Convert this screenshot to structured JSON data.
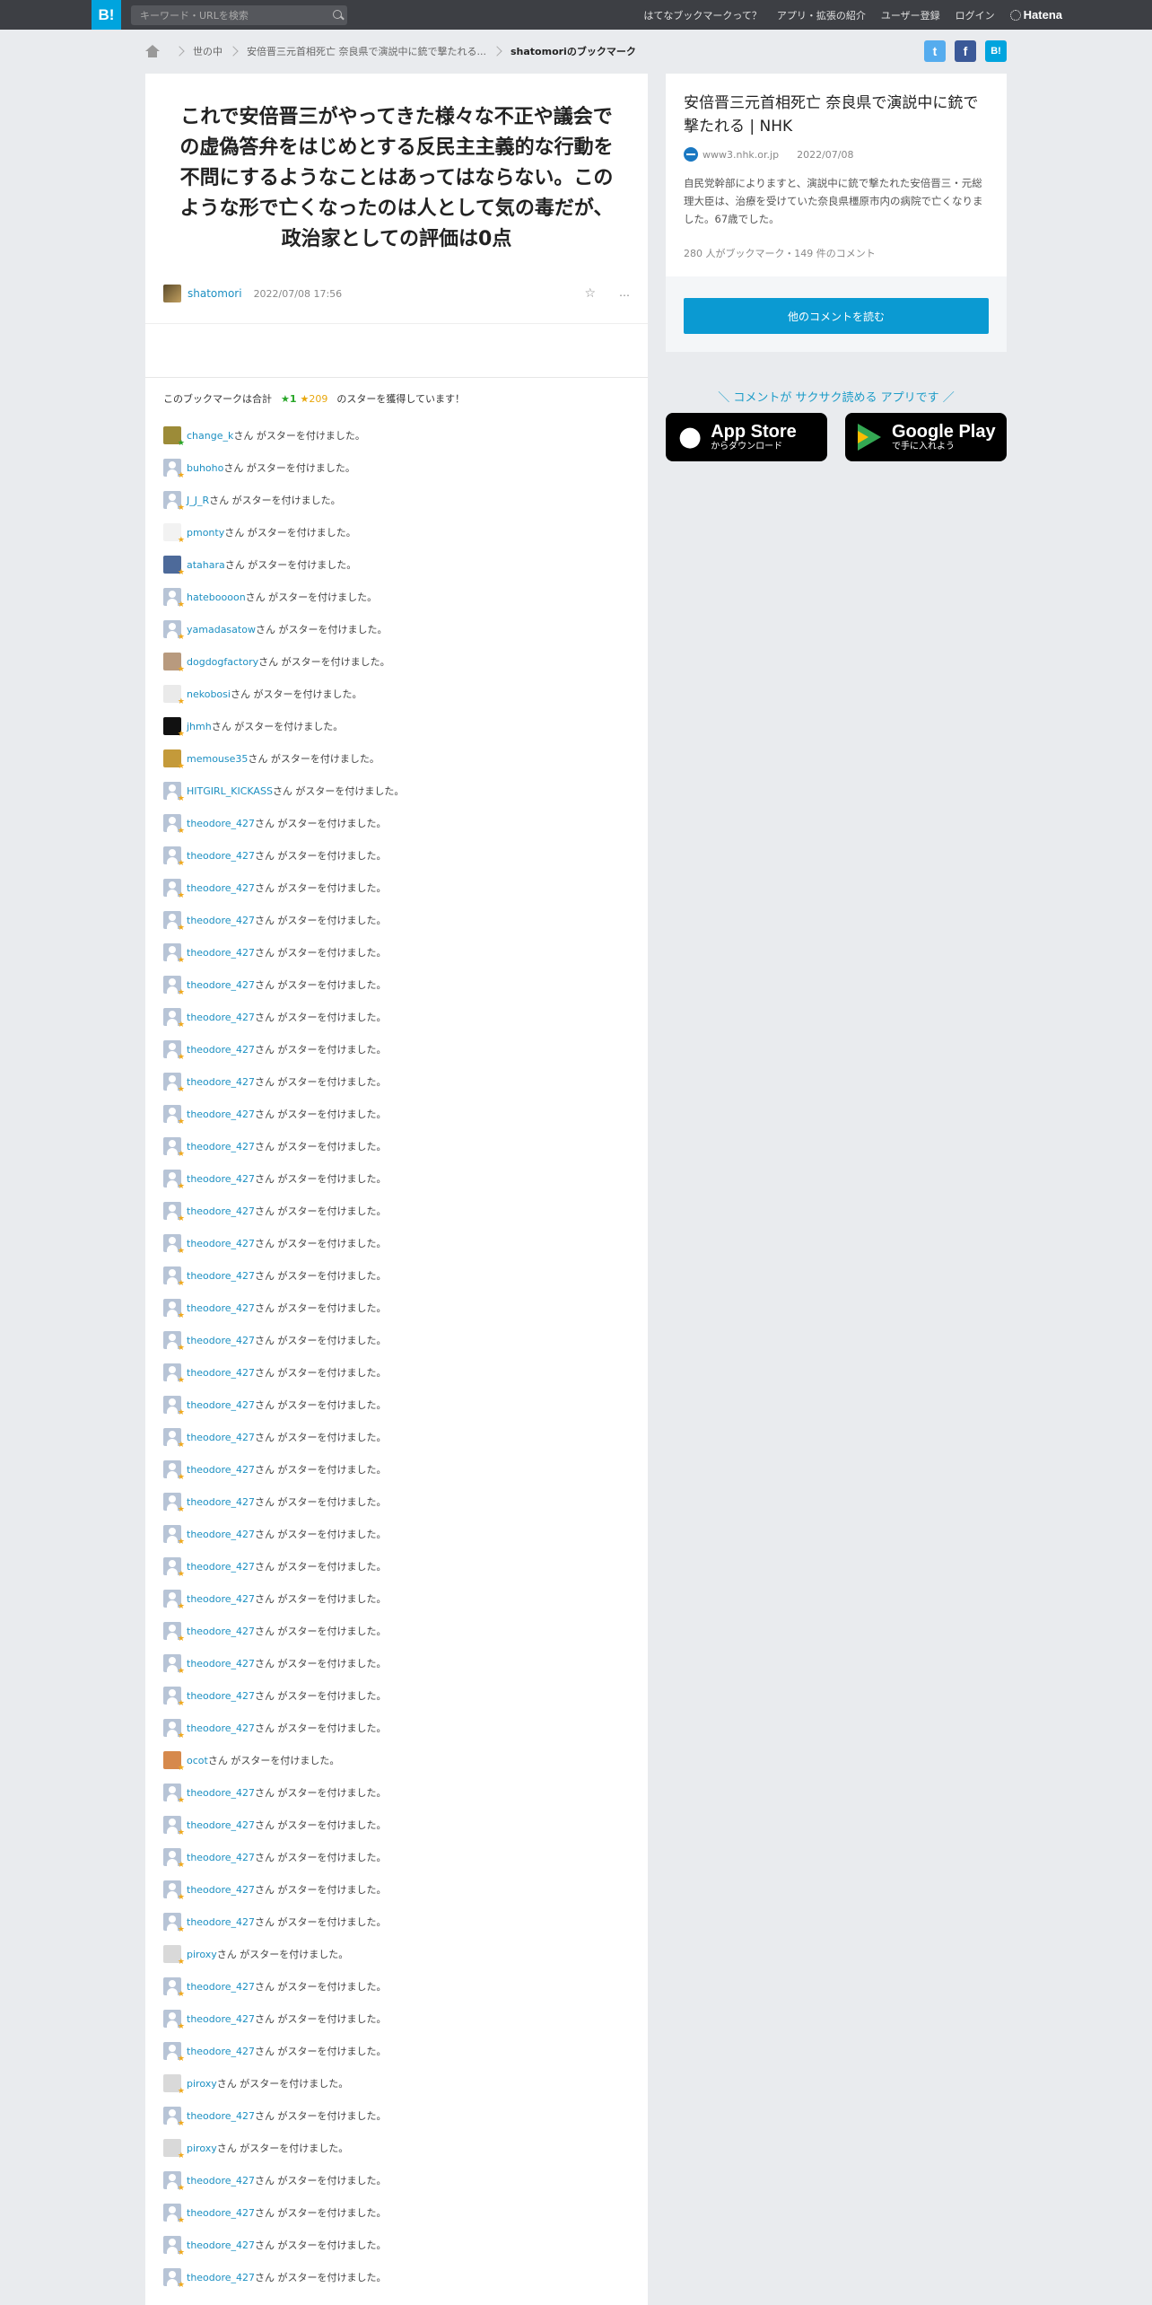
{
  "header": {
    "logo": "B!",
    "search_placeholder": "キーワード・URLを検索",
    "nav": [
      "はてなブックマークって？",
      "アプリ・拡張の紹介",
      "ユーザー登録",
      "ログイン"
    ],
    "hatena": "Hatena"
  },
  "breadcrumb": {
    "items": [
      "世の中",
      "安倍晋三元首相死亡 奈良県で演説中に銃で撃たれる..."
    ],
    "current": "shatomoriのブックマーク"
  },
  "share": {
    "twitter": "t",
    "facebook": "f",
    "hatebu": "B!"
  },
  "comment": {
    "text": "これで安倍晋三がやってきた様々な不正や議会での虚偽答弁をはじめとする反民主主義的な行動を不問にするようなことはあってはならない。このような形で亡くなったのは人として気の毒だが、政治家としての評価は0点",
    "user": "shatomori",
    "date": "2022/07/08 17:56",
    "more": "…"
  },
  "stars_summary": {
    "prefix": "このブックマークは合計",
    "green": "★1",
    "yellow": "★209",
    "suffix": "のスターを獲得しています！"
  },
  "star_suffix": "さん がスターを付けました。",
  "star_users": [
    {
      "name": "change_k",
      "av": "c1",
      "green": true
    },
    {
      "name": "buhoho",
      "av": "def"
    },
    {
      "name": "J_J_R",
      "av": "def"
    },
    {
      "name": "pmonty",
      "av": "c9"
    },
    {
      "name": "atahara",
      "av": "c3"
    },
    {
      "name": "hateboooon",
      "av": "def"
    },
    {
      "name": "yamadasatow",
      "av": "def"
    },
    {
      "name": "dogdogfactory",
      "av": "c4"
    },
    {
      "name": "nekobosi",
      "av": "c5"
    },
    {
      "name": "jhmh",
      "av": "c6"
    },
    {
      "name": "memouse35",
      "av": "c7"
    },
    {
      "name": "HITGIRL_KICKASS",
      "av": "def"
    },
    {
      "name": "theodore_427",
      "av": "def"
    },
    {
      "name": "theodore_427",
      "av": "def"
    },
    {
      "name": "theodore_427",
      "av": "def"
    },
    {
      "name": "theodore_427",
      "av": "def"
    },
    {
      "name": "theodore_427",
      "av": "def"
    },
    {
      "name": "theodore_427",
      "av": "def"
    },
    {
      "name": "theodore_427",
      "av": "def"
    },
    {
      "name": "theodore_427",
      "av": "def"
    },
    {
      "name": "theodore_427",
      "av": "def"
    },
    {
      "name": "theodore_427",
      "av": "def"
    },
    {
      "name": "theodore_427",
      "av": "def"
    },
    {
      "name": "theodore_427",
      "av": "def"
    },
    {
      "name": "theodore_427",
      "av": "def"
    },
    {
      "name": "theodore_427",
      "av": "def"
    },
    {
      "name": "theodore_427",
      "av": "def"
    },
    {
      "name": "theodore_427",
      "av": "def"
    },
    {
      "name": "theodore_427",
      "av": "def"
    },
    {
      "name": "theodore_427",
      "av": "def"
    },
    {
      "name": "theodore_427",
      "av": "def"
    },
    {
      "name": "theodore_427",
      "av": "def"
    },
    {
      "name": "theodore_427",
      "av": "def"
    },
    {
      "name": "theodore_427",
      "av": "def"
    },
    {
      "name": "theodore_427",
      "av": "def"
    },
    {
      "name": "theodore_427",
      "av": "def"
    },
    {
      "name": "theodore_427",
      "av": "def"
    },
    {
      "name": "theodore_427",
      "av": "def"
    },
    {
      "name": "theodore_427",
      "av": "def"
    },
    {
      "name": "theodore_427",
      "av": "def"
    },
    {
      "name": "theodore_427",
      "av": "def"
    },
    {
      "name": "ocot",
      "av": "c8"
    },
    {
      "name": "theodore_427",
      "av": "def"
    },
    {
      "name": "theodore_427",
      "av": "def"
    },
    {
      "name": "theodore_427",
      "av": "def"
    },
    {
      "name": "theodore_427",
      "av": "def"
    },
    {
      "name": "theodore_427",
      "av": "def"
    },
    {
      "name": "piroxy",
      "av": "c2"
    },
    {
      "name": "theodore_427",
      "av": "def"
    },
    {
      "name": "theodore_427",
      "av": "def"
    },
    {
      "name": "theodore_427",
      "av": "def"
    },
    {
      "name": "piroxy",
      "av": "c2"
    },
    {
      "name": "theodore_427",
      "av": "def"
    },
    {
      "name": "piroxy",
      "av": "c2"
    },
    {
      "name": "theodore_427",
      "av": "def"
    },
    {
      "name": "theodore_427",
      "av": "def"
    },
    {
      "name": "theodore_427",
      "av": "def"
    },
    {
      "name": "theodore_427",
      "av": "def"
    }
  ],
  "entry": {
    "title": "安倍晋三元首相死亡 奈良県で演説中に銃で撃たれる | NHK",
    "domain": "www3.nhk.or.jp",
    "date": "2022/07/08",
    "description": "自民党幹部によりますと、演説中に銃で撃たれた安倍晋三・元総理大臣は、治療を受けていた奈良県橿原市内の病院で亡くなりました。67歳でした。",
    "counts": "280 人がブックマーク・149 件のコメント",
    "button": "他のコメントを読む"
  },
  "promo": "＼ コメントが サクサク読める アプリです ／",
  "stores": {
    "appstore_big": "App Store",
    "appstore_small": "からダウンロード",
    "googleplay_big": "Google Play",
    "googleplay_small": "で手に入れよう"
  },
  "colors": {
    "accent": "#00a4de",
    "link": "#1c8fc2",
    "star_yellow": "#f0a91c",
    "star_green": "#27a627"
  }
}
